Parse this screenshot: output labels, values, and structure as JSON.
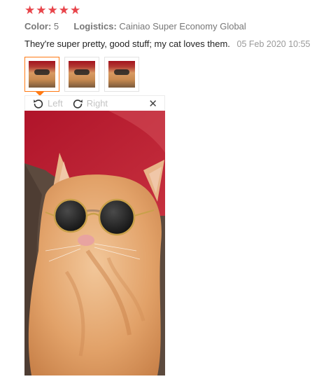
{
  "rating": {
    "stars": 5,
    "star_glyph": "★",
    "color": "#e8444a"
  },
  "meta": {
    "color_label": "Color:",
    "color_value": "5",
    "logistics_label": "Logistics:",
    "logistics_value": "Cainiao Super Economy Global"
  },
  "review": {
    "text": "They're super pretty, good stuff; my cat loves them.",
    "date": "05 Feb 2020 10:55"
  },
  "thumbnails": [
    {
      "selected": true
    },
    {
      "selected": false
    },
    {
      "selected": false
    }
  ],
  "viewer": {
    "rotate_left": "Left",
    "rotate_right": "Right",
    "close_glyph": "✕"
  },
  "colors": {
    "accent": "#ff7a14",
    "star": "#e8444a"
  }
}
